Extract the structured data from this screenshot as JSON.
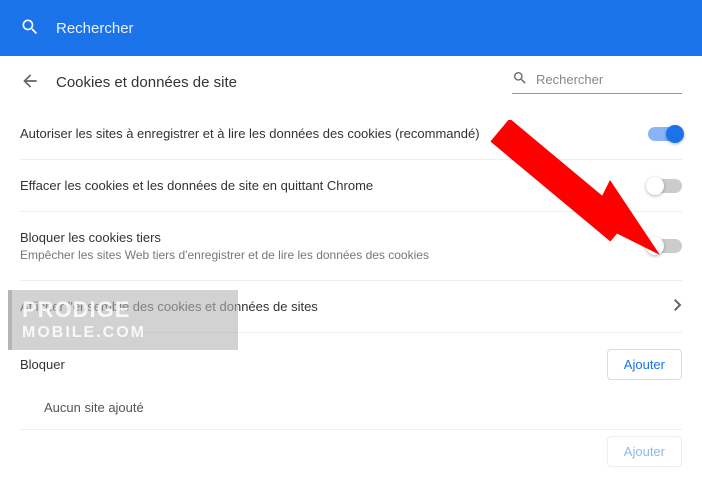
{
  "topbar": {
    "placeholder": "Rechercher"
  },
  "subheader": {
    "title": "Cookies et données de site",
    "search_placeholder": "Rechercher"
  },
  "rows": {
    "allow": {
      "label": "Autoriser les sites à enregistrer et à lire les données des cookies (recommandé)",
      "state": "on"
    },
    "clear_on_exit": {
      "label": "Effacer les cookies et les données de site en quittant Chrome",
      "state": "off"
    },
    "block_third": {
      "label": "Bloquer les cookies tiers",
      "sublabel": "Empêcher les sites Web tiers d'enregistrer et de lire les données des cookies",
      "state": "off"
    },
    "view_all": {
      "label": "Afficher l'ensemble des cookies et données de sites"
    }
  },
  "block_section": {
    "title": "Bloquer",
    "add_button": "Ajouter",
    "empty_text": "Aucun site ajouté"
  },
  "allow_section": {
    "add_button": "Ajouter"
  },
  "watermark": {
    "line1": "PRODIGE",
    "line2": "MOBILE.COM"
  }
}
